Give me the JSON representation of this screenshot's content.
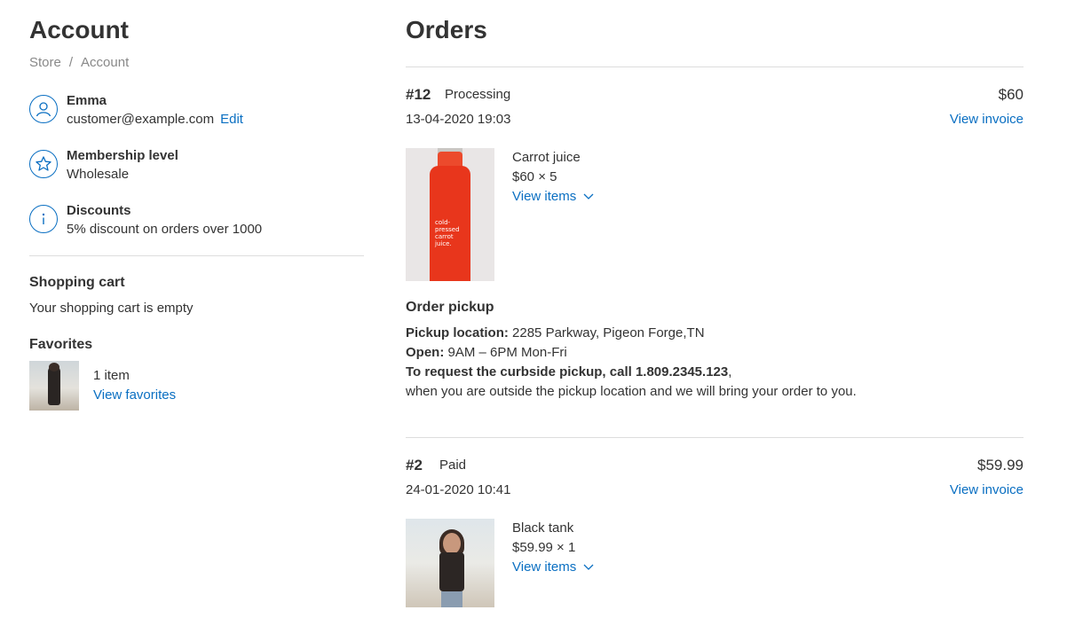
{
  "account": {
    "title": "Account",
    "breadcrumb": [
      "Store",
      "Account"
    ],
    "profile": {
      "name": "Emma",
      "email": "customer@example.com",
      "edit_label": "Edit"
    },
    "membership": {
      "title": "Membership level",
      "value": "Wholesale"
    },
    "discounts": {
      "title": "Discounts",
      "value": "5% discount on orders over 1000"
    },
    "cart": {
      "title": "Shopping cart",
      "status": "Your shopping cart is empty"
    },
    "favorites": {
      "title": "Favorites",
      "count": "1 item",
      "link": "View favorites"
    }
  },
  "orders": {
    "title": "Orders",
    "list": [
      {
        "id": "#12",
        "status": "Processing",
        "total": "$60",
        "date": "13-04-2020 19:03",
        "invoice_label": "View invoice",
        "item": {
          "name": "Carrot juice",
          "price": "$60 × 5",
          "link": "View items",
          "image_label": "cold-pressed carrot juice."
        },
        "pickup": {
          "title": "Order pickup",
          "location_label": "Pickup location:",
          "location": " 2285 Parkway, Pigeon Forge,TN",
          "open_label": "Open:",
          "open": " 9AM – 6PM Mon-Fri",
          "request": "To request the curbside pickup, call 1.809.2345.123",
          "request_tail": ",",
          "note": "when you are outside the pickup location and we will bring your order to you."
        }
      },
      {
        "id": "#2",
        "status": "Paid",
        "total": "$59.99",
        "date": "24-01-2020 10:41",
        "invoice_label": "View invoice",
        "item": {
          "name": "Black tank",
          "price": "$59.99 × 1",
          "link": "View items"
        }
      }
    ]
  },
  "colors": {
    "link": "#0a6fc2",
    "text": "#333333",
    "muted": "#888888",
    "divider": "#dddddd"
  }
}
